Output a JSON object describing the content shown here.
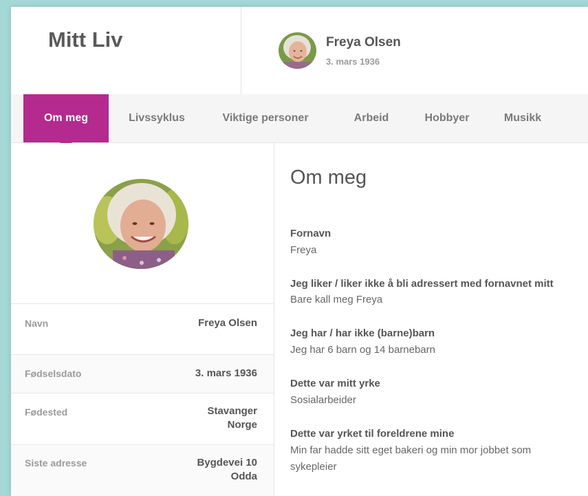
{
  "app": {
    "title": "Mitt Liv"
  },
  "user": {
    "name": "Freya Olsen",
    "birth_date": "3. mars 1936"
  },
  "tabs": [
    {
      "label": "Om meg",
      "active": true
    },
    {
      "label": "Livssyklus",
      "active": false
    },
    {
      "label": "Viktige personer",
      "active": false
    },
    {
      "label": "Arbeid",
      "active": false
    },
    {
      "label": "Hobbyer",
      "active": false
    },
    {
      "label": "Musikk",
      "active": false
    }
  ],
  "profile": {
    "rows": [
      {
        "label": "Navn",
        "value": "Freya Olsen",
        "value2": ""
      },
      {
        "label": "Fødselsdato",
        "value": "3. mars 1936",
        "value2": ""
      },
      {
        "label": "Fødested",
        "value": "Stavanger",
        "value2": "Norge"
      },
      {
        "label": "Siste adresse",
        "value": "Bygdevei 10",
        "value2": "Odda"
      }
    ]
  },
  "about": {
    "title": "Om meg",
    "fields": [
      {
        "label": "Fornavn",
        "value": "Freya"
      },
      {
        "label": "Jeg liker / liker ikke å bli adressert med fornavnet mitt",
        "value": "Bare kall meg Freya"
      },
      {
        "label": "Jeg har / har ikke (barne)barn",
        "value": "Jeg har 6 barn og 14 barnebarn"
      },
      {
        "label": "Dette var mitt yrke",
        "value": "Sosialarbeider"
      },
      {
        "label": "Dette var yrket til foreldrene mine",
        "value": "Min far hadde sitt eget bakeri og min mor jobbet som sykepleier"
      }
    ]
  },
  "colors": {
    "accent": "#b42a8f",
    "background": "#a4d8d6"
  }
}
